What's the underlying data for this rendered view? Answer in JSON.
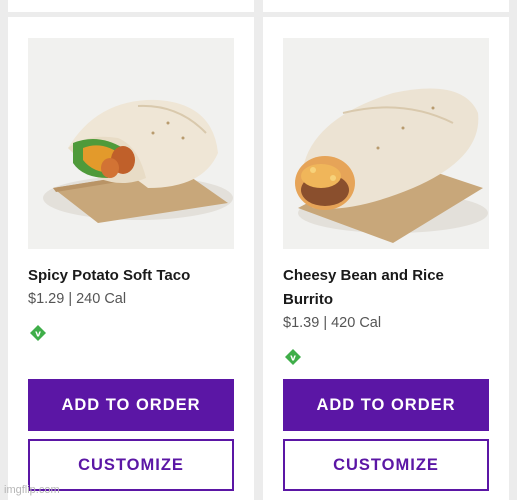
{
  "colors": {
    "brand_purple": "#5b16a5",
    "veg_green": "#3fae49",
    "background": "#ececec"
  },
  "products": [
    {
      "name": "Spicy Potato Soft Taco",
      "meta": "$1.29 | 240 Cal",
      "badge_icon": "vegetarian-icon",
      "add_label": "ADD TO ORDER",
      "customize_label": "CUSTOMIZE"
    },
    {
      "name": "Cheesy Bean and Rice Burrito",
      "meta": "$1.39 | 420 Cal",
      "badge_icon": "vegetarian-icon",
      "add_label": "ADD TO ORDER",
      "customize_label": "CUSTOMIZE"
    }
  ],
  "watermark": "imgflip.com"
}
